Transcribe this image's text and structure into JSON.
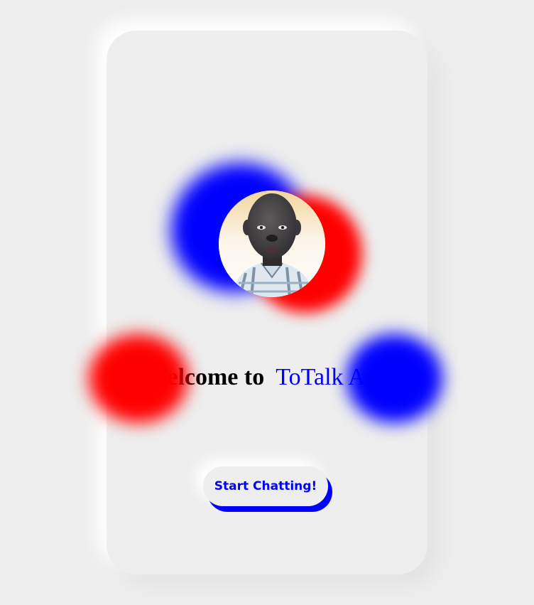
{
  "welcome": {
    "prefix": "Welcome to",
    "app_name": "ToTalk App"
  },
  "cta": {
    "label": "Start Chatting!"
  },
  "avatar": {
    "icon": "profile-photo"
  },
  "colors": {
    "background": "#eeeeee",
    "accent_blue": "#0000ff",
    "accent_red": "#ff0000",
    "heading_text": "#000000"
  }
}
